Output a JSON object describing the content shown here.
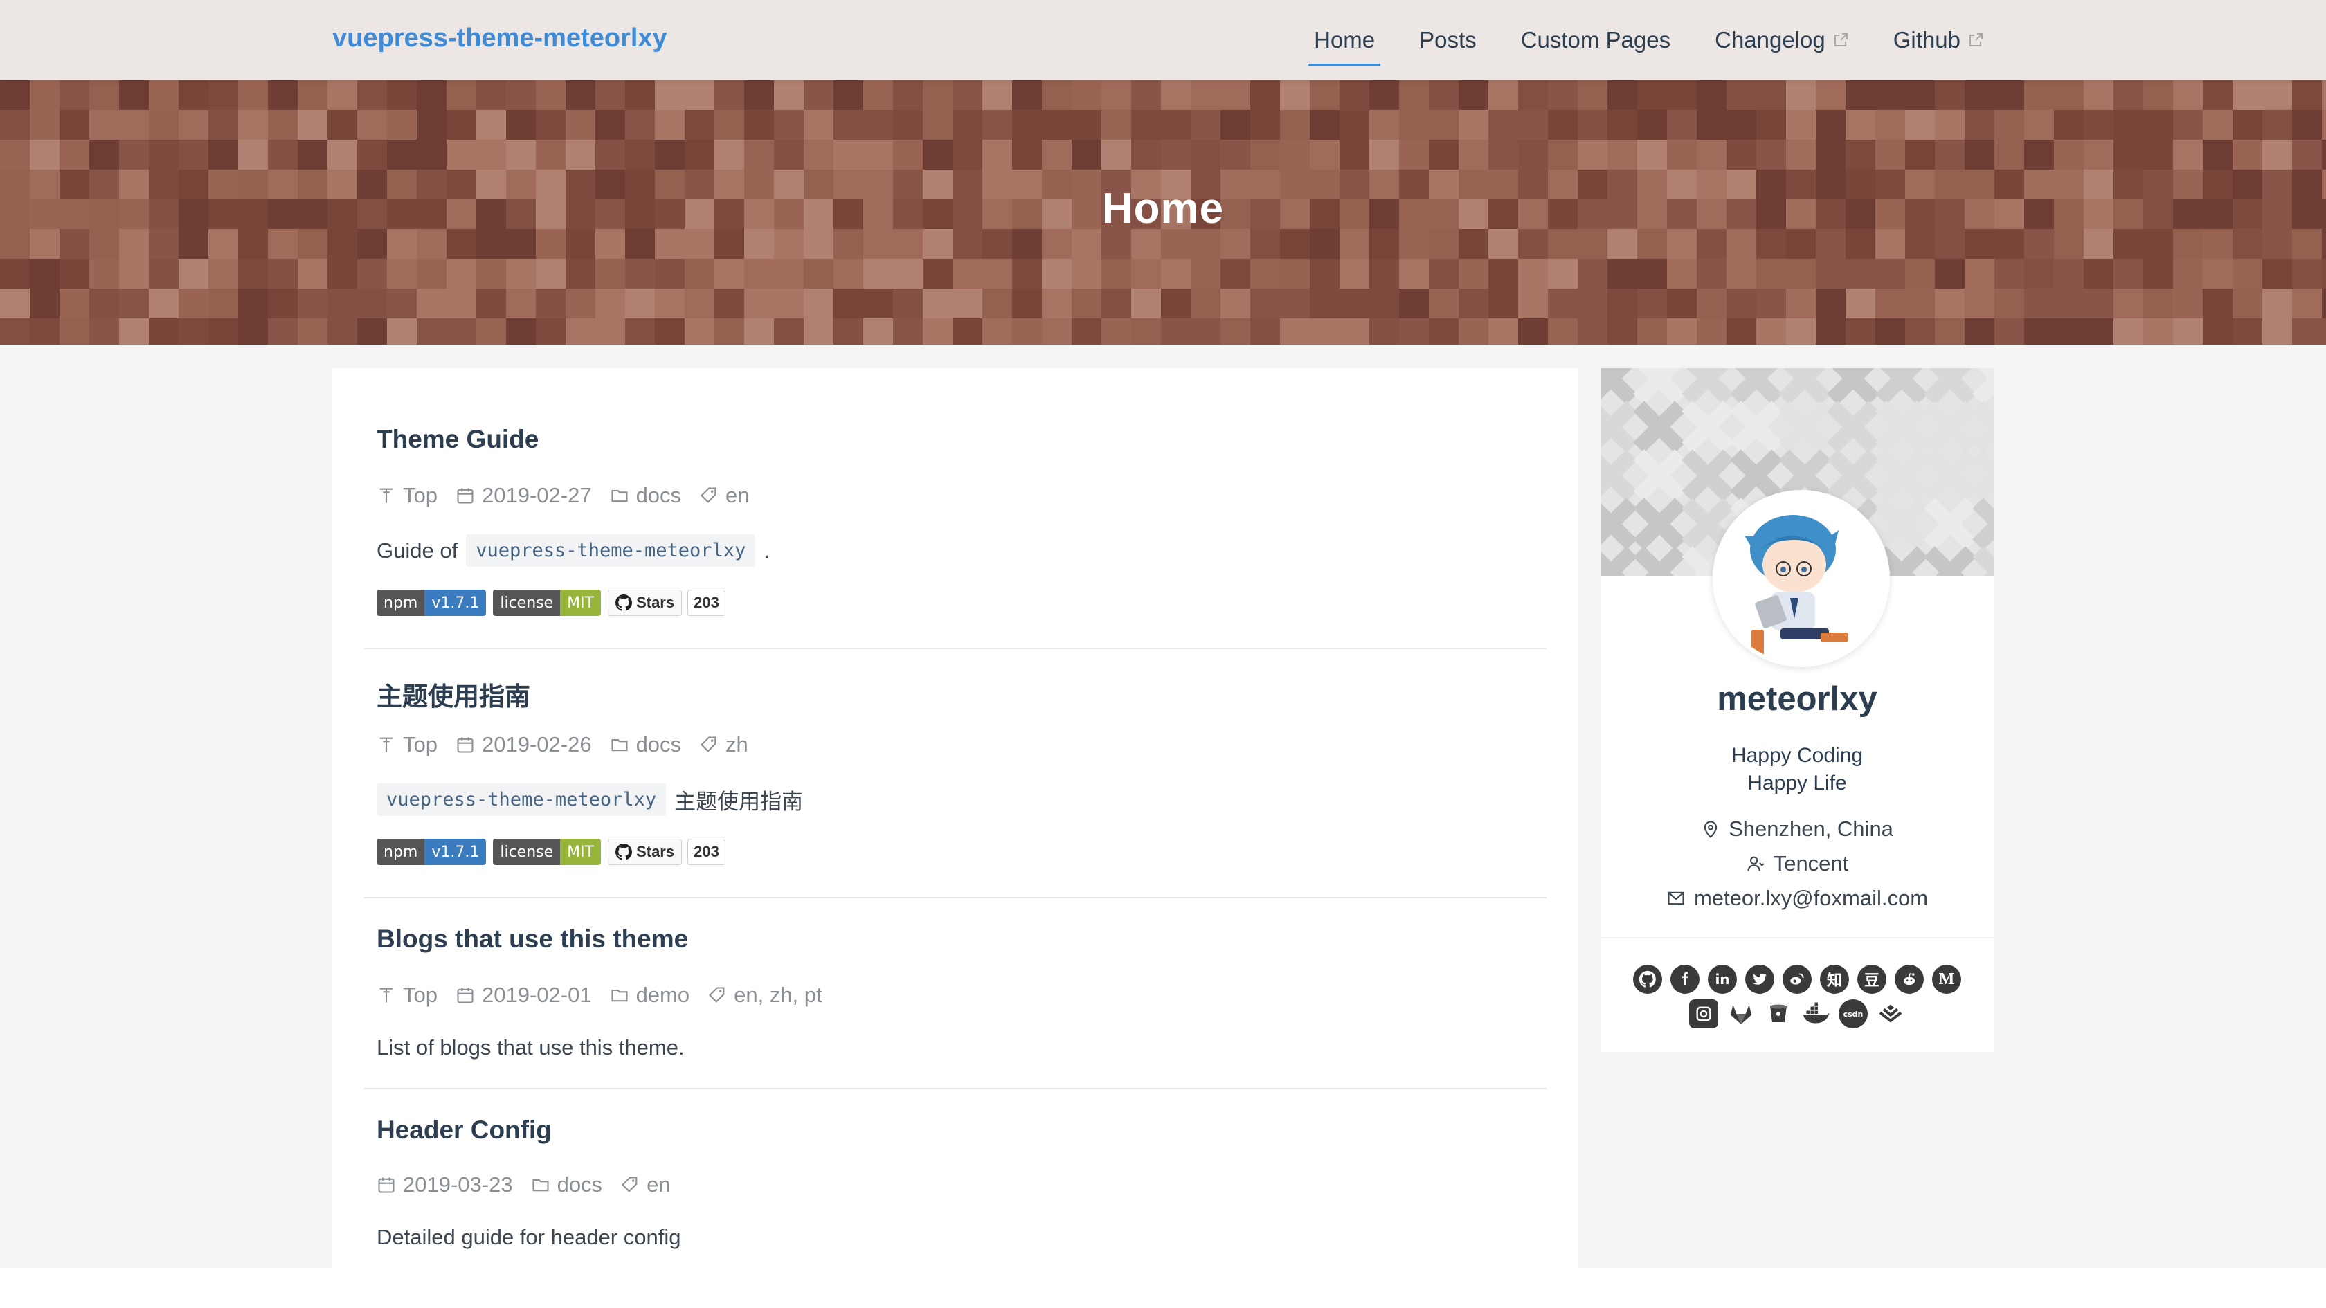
{
  "navbar": {
    "brand": "vuepress-theme-meteorlxy",
    "links": [
      {
        "label": "Home",
        "active": true,
        "external": false
      },
      {
        "label": "Posts",
        "active": false,
        "external": false
      },
      {
        "label": "Custom Pages",
        "active": false,
        "external": false
      },
      {
        "label": "Changelog",
        "active": false,
        "external": true
      },
      {
        "label": "Github",
        "active": false,
        "external": true
      }
    ]
  },
  "banner": {
    "title": "Home"
  },
  "posts": [
    {
      "title": "Theme Guide",
      "top_label": "Top",
      "date": "2019-02-27",
      "category": "docs",
      "tags": "en",
      "summary_prefix": "Guide of",
      "summary_code": "vuepress-theme-meteorlxy",
      "summary_suffix": ".",
      "badges": {
        "npm_label": "npm",
        "npm_version": "v1.7.1",
        "license_label": "license",
        "license_value": "MIT",
        "stars_label": "Stars",
        "stars_count": "203"
      }
    },
    {
      "title": "主题使用指南",
      "top_label": "Top",
      "date": "2019-02-26",
      "category": "docs",
      "tags": "zh",
      "summary_code": "vuepress-theme-meteorlxy",
      "summary_suffix": "主题使用指南",
      "badges": {
        "npm_label": "npm",
        "npm_version": "v1.7.1",
        "license_label": "license",
        "license_value": "MIT",
        "stars_label": "Stars",
        "stars_count": "203"
      }
    },
    {
      "title": "Blogs that use this theme",
      "top_label": "Top",
      "date": "2019-02-01",
      "category": "demo",
      "tags": "en, zh, pt",
      "summary": "List of blogs that use this theme."
    },
    {
      "title": "Header Config",
      "date": "2019-03-23",
      "category": "docs",
      "tags": "en",
      "summary": "Detailed guide for header config"
    }
  ],
  "profile": {
    "name": "meteorlxy",
    "bio_line1": "Happy Coding",
    "bio_line2": "Happy Life",
    "location": "Shenzhen, China",
    "organization": "Tencent",
    "email": "meteor.lxy@foxmail.com",
    "socials_row1": [
      "github-icon",
      "facebook-icon",
      "linkedin-icon",
      "twitter-icon",
      "weibo-icon",
      "zhihu-icon",
      "douban-icon",
      "reddit-icon",
      "medium-icon"
    ],
    "socials_row2": [
      "instagram-icon",
      "gitlab-icon",
      "bitbucket-icon",
      "docker-icon",
      "csdn-icon",
      "juejin-icon"
    ],
    "social_glyphs": {
      "zhihu": "知",
      "douban": "豆",
      "medium": "M",
      "csdn": "csdn"
    }
  },
  "colors": {
    "accent": "#3e8bd8",
    "banner": "#8a5549",
    "npm_version": "#3a7cbf",
    "license_mit": "#97b43b"
  }
}
